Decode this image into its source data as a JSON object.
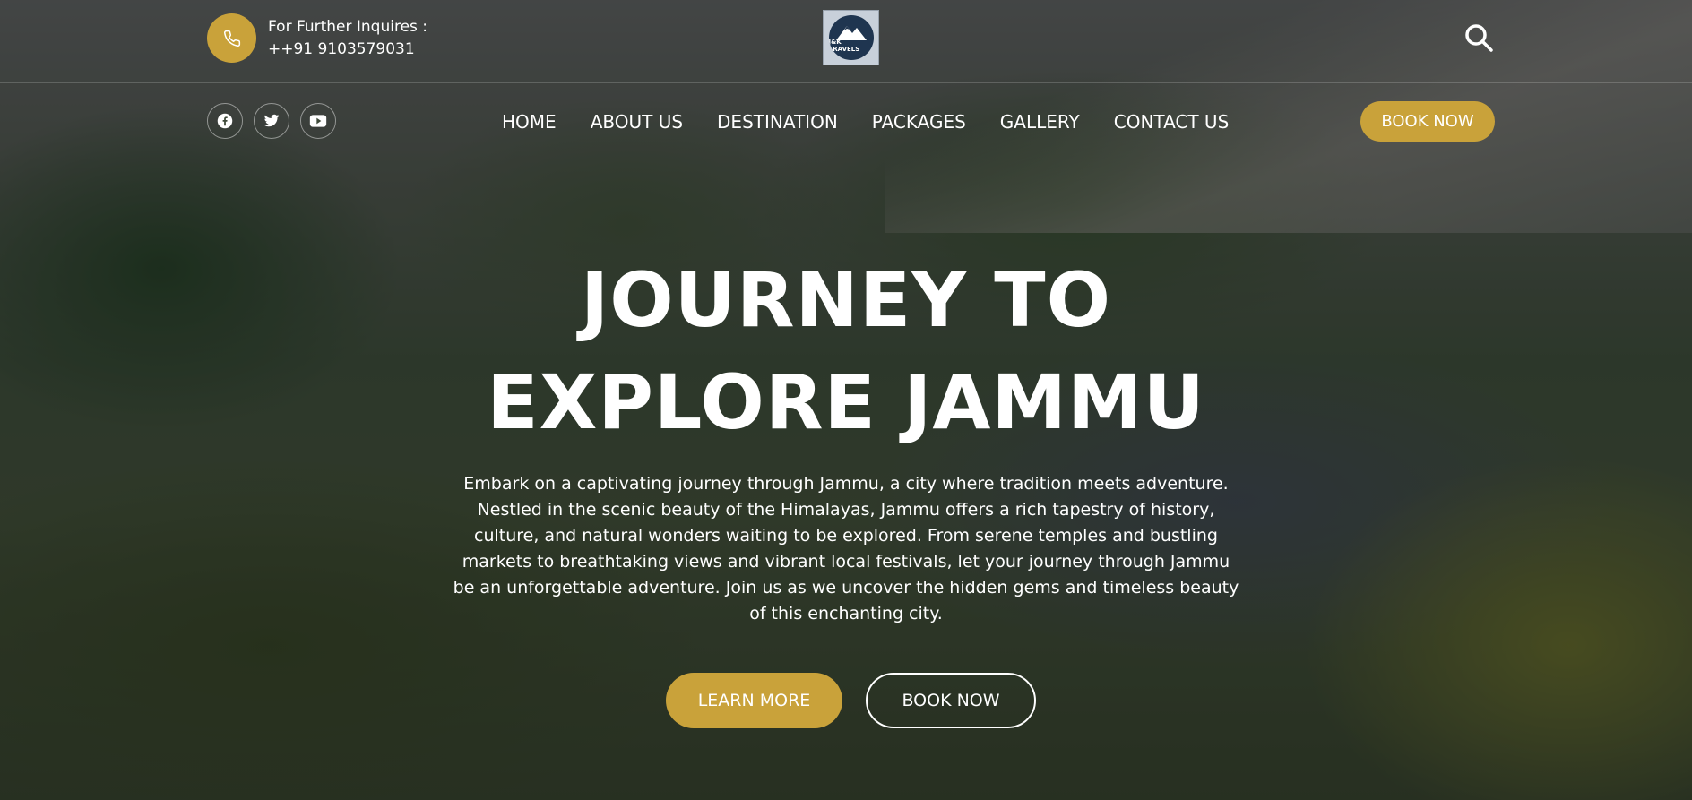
{
  "header": {
    "contact_label": "For Further Inquires :",
    "contact_phone": "++91 9103579031",
    "logo_text": "J&K TRAVELS"
  },
  "social": {
    "icons": [
      "facebook-icon",
      "twitter-icon",
      "youtube-icon"
    ]
  },
  "nav": {
    "items": [
      {
        "label": "HOME"
      },
      {
        "label": "ABOUT US"
      },
      {
        "label": "DESTINATION"
      },
      {
        "label": "PACKAGES"
      },
      {
        "label": "GALLERY"
      },
      {
        "label": "CONTACT US"
      }
    ],
    "book_label": "BOOK NOW"
  },
  "hero": {
    "title_line1": "JOURNEY TO",
    "title_line2": "EXPLORE JAMMU",
    "description": "Embark on a captivating journey through Jammu, a city where tradition meets adventure. Nestled in the scenic beauty of the Himalayas, Jammu offers a rich tapestry of history, culture, and natural wonders waiting to be explored. From serene temples and bustling markets to breathtaking views and vibrant local festivals, let your journey through Jammu be an unforgettable adventure. Join us as we uncover the hidden gems and timeless beauty of this enchanting city.",
    "learn_more_label": "LEARN MORE",
    "book_now_label": "BOOK NOW"
  },
  "colors": {
    "accent": "#c9a23a",
    "text": "#ffffff"
  }
}
